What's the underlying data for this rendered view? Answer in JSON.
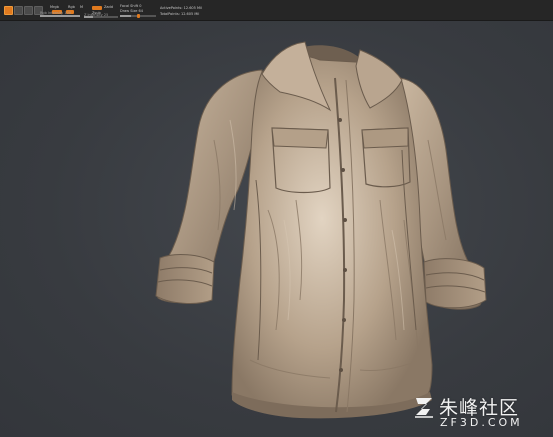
{
  "toolbar": {
    "brush_label": "Brush",
    "rgb_label": "Rgb",
    "mrgb_label": "Mrgb",
    "m_label": "M",
    "zadd_label": "Zadd",
    "zsub_label": "Zsub",
    "z_intensity_label": "Z Intensity 25",
    "rgb_intensity_label": "Rgb Intensity 100",
    "focal_shift_label": "Focal Shift 0",
    "draw_size_label": "Draw Size 64",
    "active_points_label": "ActivePoints: 12.605 Mil",
    "total_points_label": "TotalPoints: 12.605 Mil",
    "z_intensity": 0.25,
    "rgb_intensity": 1.0,
    "draw_size": 0.3,
    "accent_color": "#e07a1f"
  },
  "viewport": {
    "subject": "shirt-sculpt",
    "background_color": "#3a3d42",
    "clay_color": "#b8a48e"
  },
  "watermark": {
    "title": "朱峰社区",
    "url": "ZF3D.COM",
    "logo_icon": "zf-logo-icon"
  }
}
